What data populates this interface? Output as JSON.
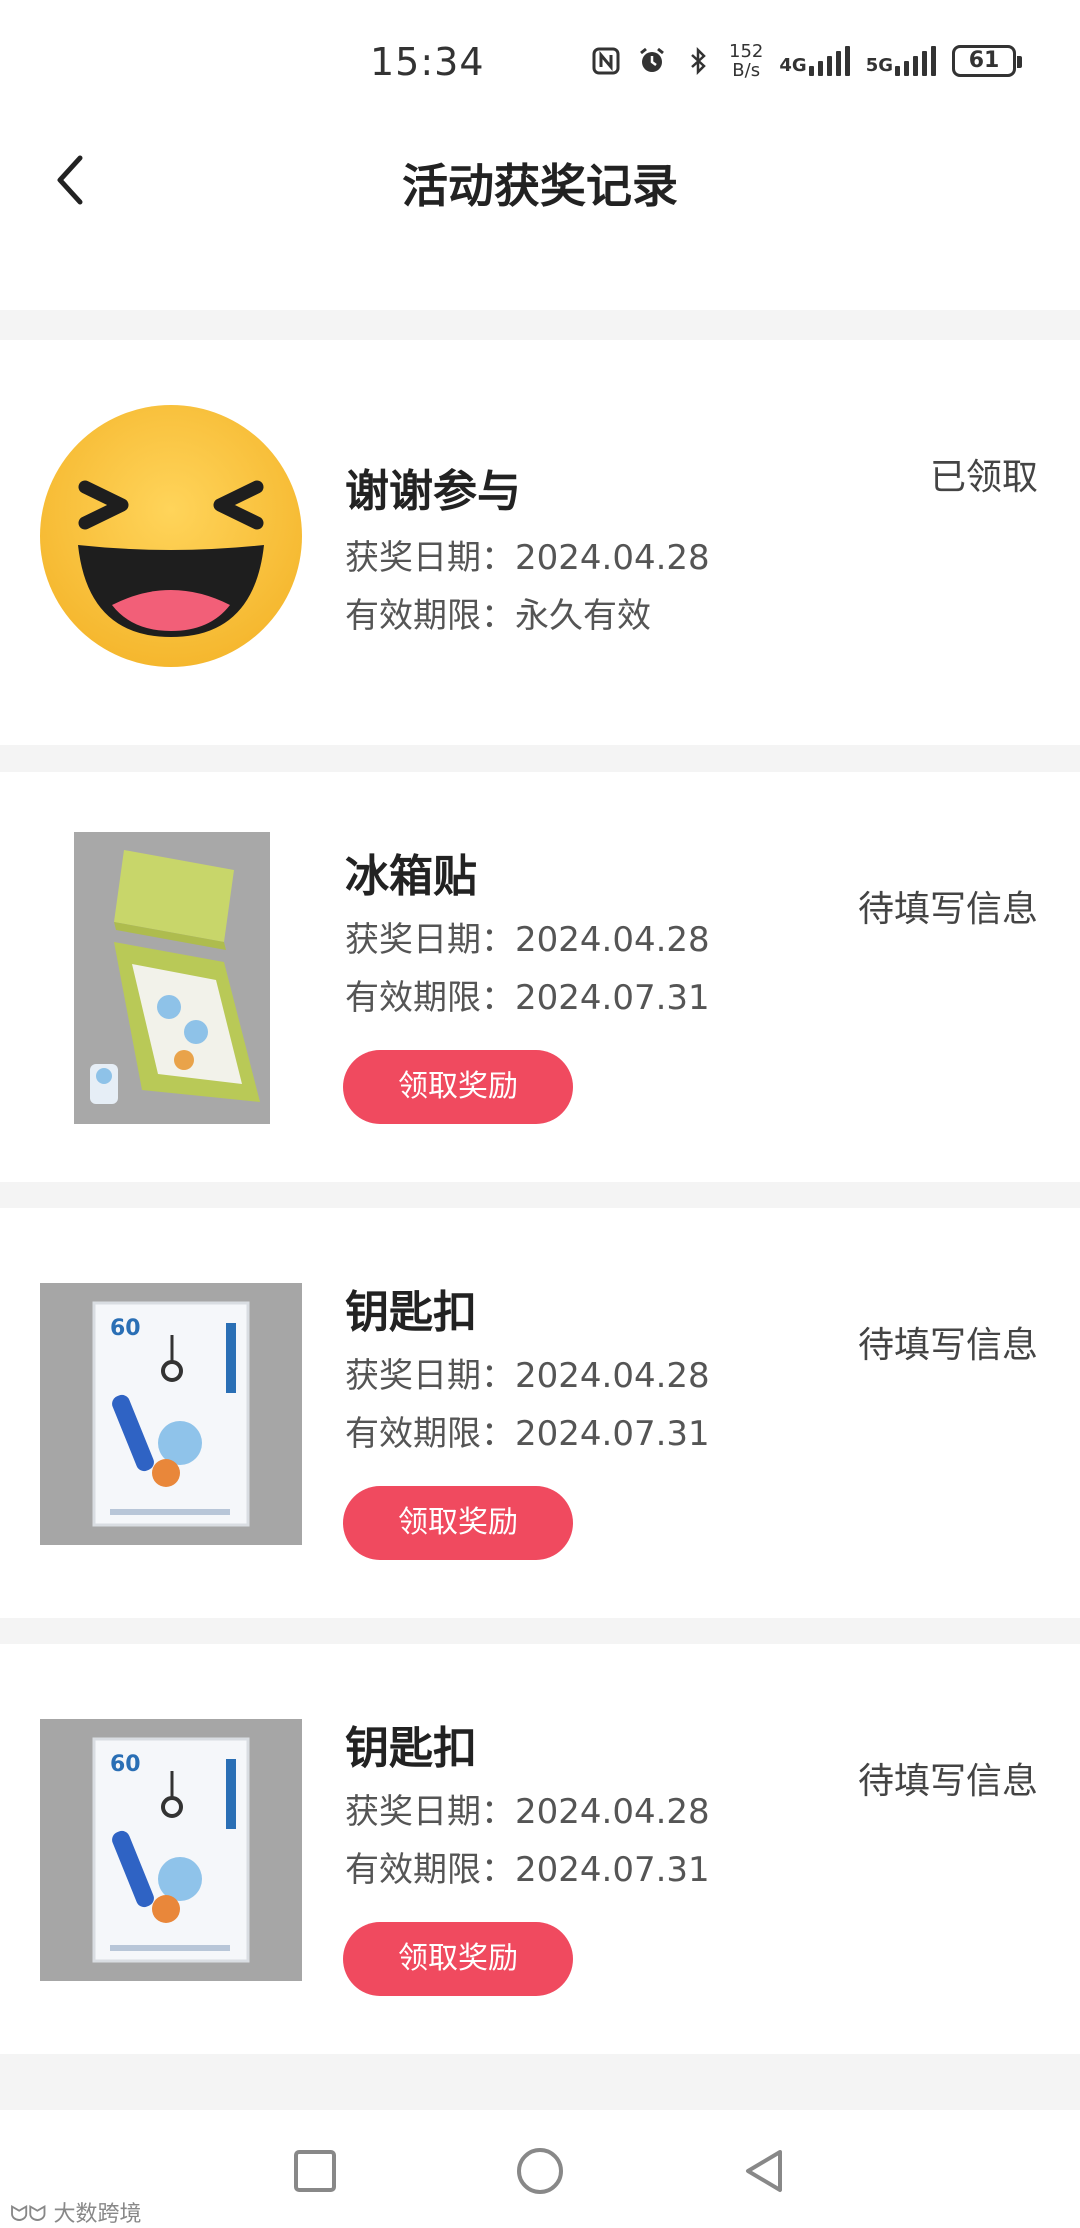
{
  "status_bar": {
    "time": "15:34",
    "net_speed_value": "152",
    "net_speed_unit": "B/s",
    "sig1_label": "4G",
    "sig2_label": "5G",
    "battery": "61"
  },
  "header": {
    "title": "活动获奖记录"
  },
  "prizes": [
    {
      "name": "谢谢参与",
      "date_label": "获奖日期：",
      "date_value": "2024.04.28",
      "expiry_label": "有效期限：",
      "expiry_value": "永久有效",
      "status": "已领取",
      "image": "laughing-emoji"
    },
    {
      "name": "冰箱贴",
      "date_label": "获奖日期：",
      "date_value": "2024.04.28",
      "expiry_label": "有效期限：",
      "expiry_value": "2024.07.31",
      "status": "待填写信息",
      "button": "领取奖励",
      "image": "fridge-magnet-box"
    },
    {
      "name": "钥匙扣",
      "date_label": "获奖日期：",
      "date_value": "2024.04.28",
      "expiry_label": "有效期限：",
      "expiry_value": "2024.07.31",
      "status": "待填写信息",
      "button": "领取奖励",
      "image": "keychain-package"
    },
    {
      "name": "钥匙扣",
      "date_label": "获奖日期：",
      "date_value": "2024.04.28",
      "expiry_label": "有效期限：",
      "expiry_value": "2024.07.31",
      "status": "待填写信息",
      "button": "领取奖励",
      "image": "keychain-package"
    }
  ],
  "watermark": "大数跨境",
  "colors": {
    "accent": "#f04a5f",
    "background": "#f4f4f4",
    "card": "#ffffff"
  }
}
